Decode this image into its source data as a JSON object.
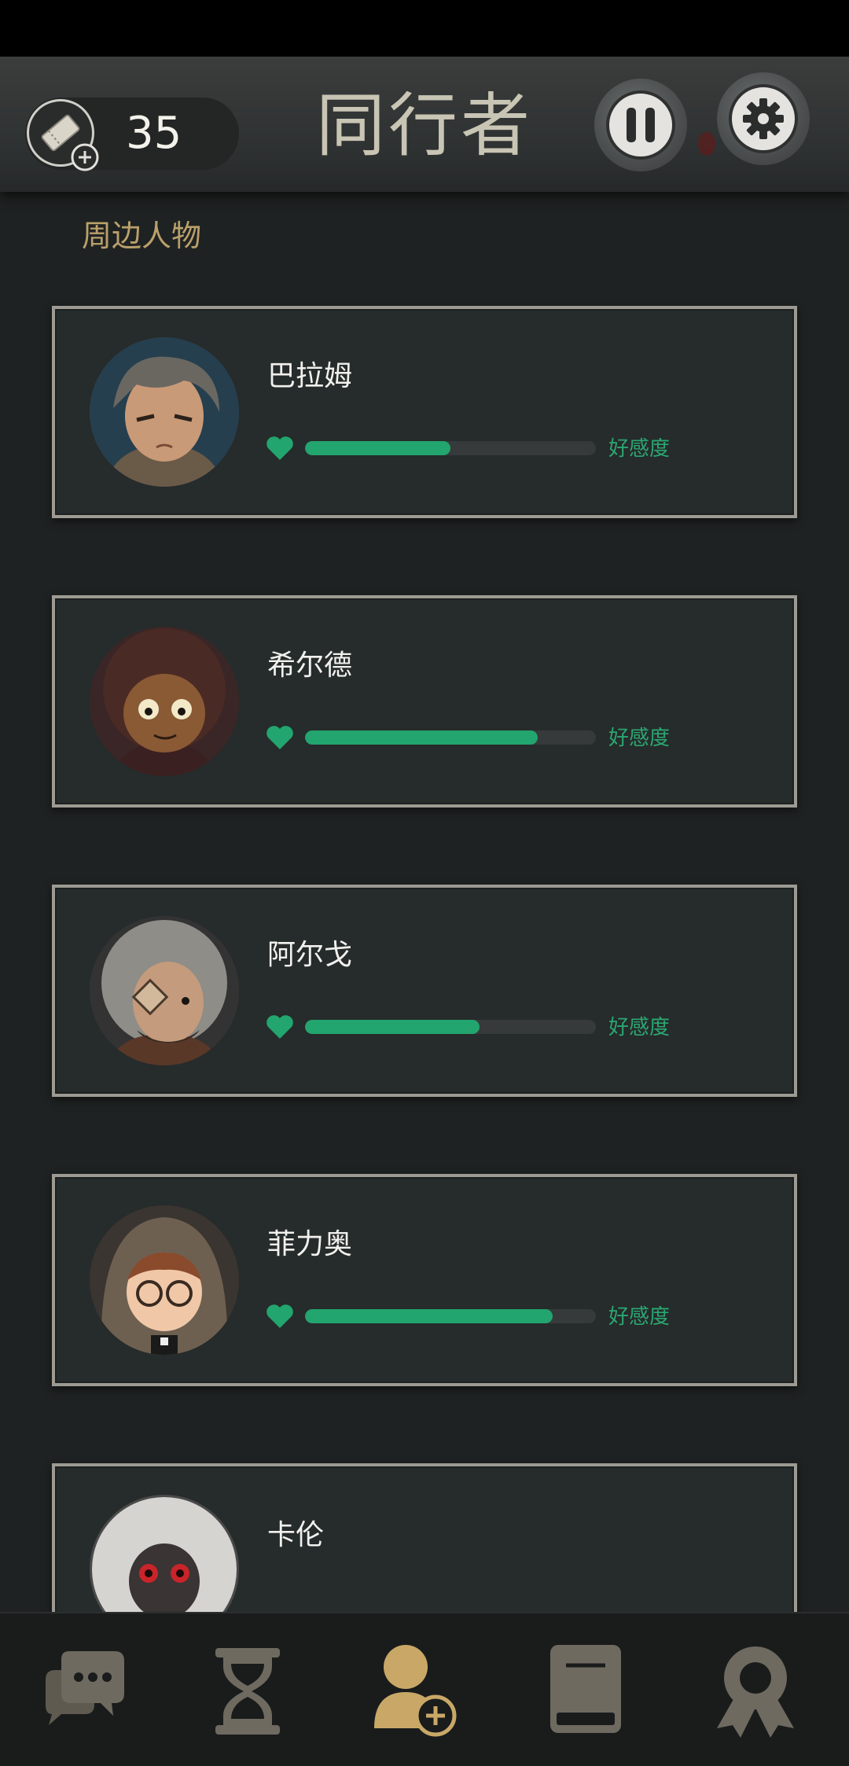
{
  "header": {
    "title": "同行者",
    "ticket_count": "35"
  },
  "section": {
    "label": "周边人物"
  },
  "companions": [
    {
      "name": "巴拉姆",
      "affinity_label": "好感度",
      "affinity": 0.5
    },
    {
      "name": "希尔德",
      "affinity_label": "好感度",
      "affinity": 0.8
    },
    {
      "name": "阿尔戈",
      "affinity_label": "好感度",
      "affinity": 0.6
    },
    {
      "name": "菲力奥",
      "affinity_label": "好感度",
      "affinity": 0.85
    },
    {
      "name": "卡伦"
    }
  ],
  "colors": {
    "accent_green": "#22a56e",
    "gold": "#c9a867",
    "nav_inactive": "#6e6a60"
  },
  "nav": [
    {
      "icon": "chat-bubbles-icon",
      "active": false
    },
    {
      "icon": "hourglass-icon",
      "active": false
    },
    {
      "icon": "add-person-icon",
      "active": true
    },
    {
      "icon": "book-icon",
      "active": false
    },
    {
      "icon": "award-ribbon-icon",
      "active": false
    }
  ]
}
